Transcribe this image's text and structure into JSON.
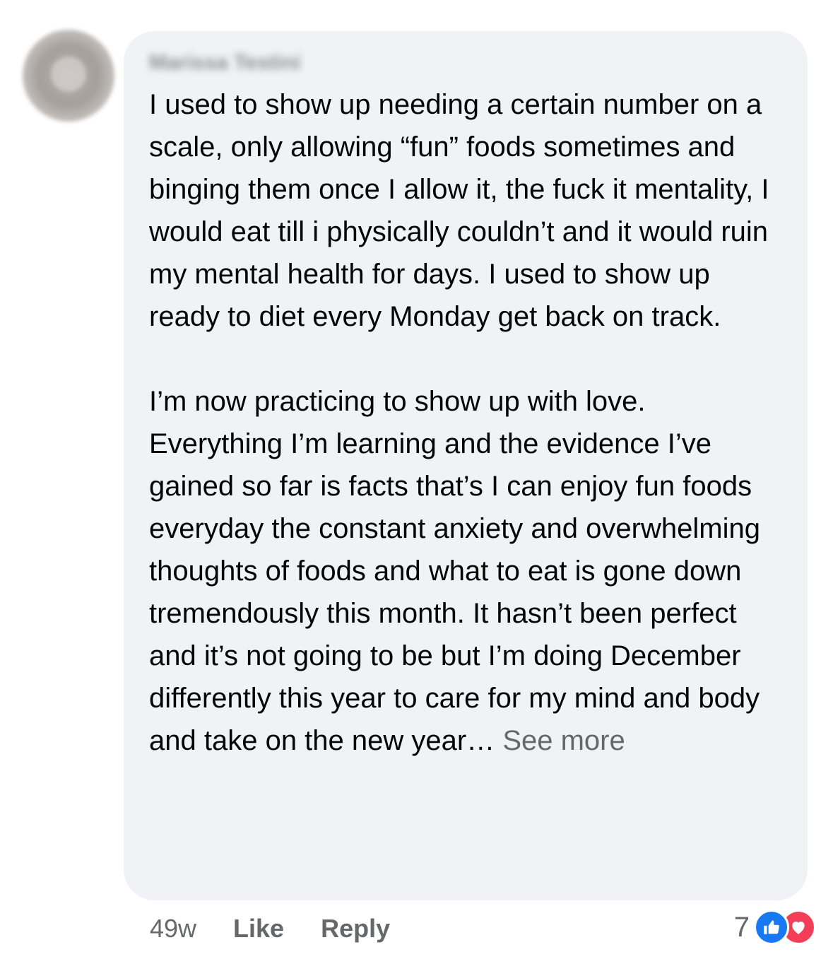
{
  "comment": {
    "author": "Marissa Testini",
    "paragraphs": [
      "I used to show up needing a certain number on a scale, only allowing “fun” foods sometimes and binging them once I allow it, the fuck it mentality, I would eat till i physically couldn’t and it would ruin my mental health for days. I used to show up ready to diet every Monday get back on track.",
      "I’m now practicing to show up with love. Everything I’m learning and the evidence I’ve gained so far is facts that’s I can enjoy fun foods everyday the constant anxiety and overwhelming thoughts of foods and what to eat is gone down tremendously this month. It hasn’t been perfect and it’s not going to be but I’m doing December differently this year to care for my mind and body and take on the new year…"
    ],
    "see_more_label": "See more"
  },
  "actions": {
    "time": "49w",
    "like_label": "Like",
    "reply_label": "Reply"
  },
  "reactions": {
    "count": "7",
    "icons": [
      "like-icon",
      "love-icon"
    ],
    "like_color": "#1877f2",
    "love_color": "#f33e58"
  }
}
